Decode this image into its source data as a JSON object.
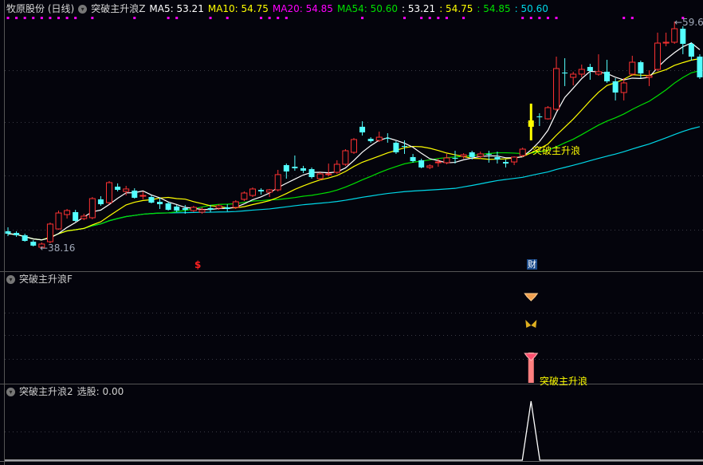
{
  "header": {
    "title": "牧原股份 (日线)",
    "indicator": "突破主升浪Z",
    "ma5_label": "MA5: 53.21",
    "ma10_label": "MA10: 54.75",
    "ma20_label": "MA20: 54.85",
    "ma54_label": "MA54: 50.60",
    "v1": ": 53.21",
    "v2": ": 54.75",
    "v3": ": 54.85",
    "v4": ": 50.60"
  },
  "panel2": {
    "title": "突破主升浪F",
    "signal_label": "突破主升浪"
  },
  "panel3": {
    "title": "突破主升浪2",
    "value_label": "选股: 0.00"
  },
  "markers": {
    "low_label": "←38.16",
    "high_label": "←59.6",
    "signal_label": "突破主升浪",
    "dollar": "$",
    "cai": "财"
  },
  "colors": {
    "up": "#ff3232",
    "down": "#54ffff",
    "signal": "#ffff00",
    "ma5": "#ffffff",
    "ma10": "#ffff00",
    "ma20": "#00e000",
    "ma54": "#00d8e8",
    "dots": "#ff00ff"
  },
  "chart_data": {
    "type": "candlestick",
    "title": "牧原股份 (日线)",
    "price_range": [
      38.16,
      59.6
    ],
    "signal_index": 62,
    "dollar_index": 23,
    "dot_indices": [
      0,
      1,
      2,
      3,
      4,
      5,
      6,
      7,
      8,
      10,
      15,
      19,
      20,
      24,
      26,
      30,
      31,
      32,
      33,
      42,
      47,
      49,
      50,
      51,
      52,
      54,
      61,
      62,
      63,
      64,
      65,
      73,
      74,
      80
    ],
    "ohlc": [
      [
        39.75,
        39.52,
        40.12,
        39.29
      ],
      [
        39.59,
        39.37,
        39.75,
        39.22
      ],
      [
        39.37,
        38.84,
        39.52,
        38.76
      ],
      [
        38.76,
        38.39,
        38.91,
        38.31
      ],
      [
        38.24,
        38.54,
        38.69,
        38.16
      ],
      [
        38.76,
        40.43,
        40.58,
        38.61
      ],
      [
        39.97,
        41.48,
        41.71,
        39.9
      ],
      [
        41.33,
        41.71,
        41.86,
        40.95
      ],
      [
        41.56,
        40.73,
        41.78,
        40.65
      ],
      [
        40.95,
        41.18,
        41.41,
        40.8
      ],
      [
        41.03,
        42.84,
        42.99,
        40.88
      ],
      [
        42.77,
        42.31,
        43.07,
        42.16
      ],
      [
        42.46,
        44.35,
        44.5,
        42.31
      ],
      [
        43.97,
        43.67,
        44.28,
        43.52
      ],
      [
        43.52,
        43.75,
        44.05,
        43.14
      ],
      [
        43.6,
        42.92,
        43.82,
        42.84
      ],
      [
        43.07,
        43.14,
        43.52,
        42.77
      ],
      [
        42.99,
        42.46,
        43.14,
        42.39
      ],
      [
        42.54,
        42.31,
        42.92,
        41.86
      ],
      [
        42.39,
        41.78,
        42.54,
        41.71
      ],
      [
        42.09,
        41.71,
        42.24,
        41.56
      ],
      [
        41.94,
        41.78,
        42.24,
        41.41
      ],
      [
        41.71,
        42.01,
        42.16,
        41.56
      ],
      [
        41.56,
        41.78,
        42.01,
        41.41
      ],
      [
        41.94,
        41.78,
        42.24,
        41.56
      ],
      [
        41.94,
        42.16,
        42.31,
        41.78
      ],
      [
        42.01,
        41.86,
        42.31,
        41.63
      ],
      [
        42.01,
        42.54,
        42.69,
        41.86
      ],
      [
        42.77,
        43.37,
        43.52,
        42.61
      ],
      [
        43.14,
        43.75,
        43.9,
        42.99
      ],
      [
        43.67,
        43.52,
        43.82,
        43.22
      ],
      [
        43.45,
        43.67,
        43.75,
        42.99
      ],
      [
        43.67,
        45.11,
        45.56,
        43.52
      ],
      [
        46.01,
        45.41,
        46.16,
        44.73
      ],
      [
        45.86,
        45.71,
        46.92,
        45.48
      ],
      [
        45.71,
        45.48,
        45.94,
        45.26
      ],
      [
        45.63,
        44.88,
        45.79,
        44.73
      ],
      [
        44.73,
        45.18,
        45.33,
        44.58
      ],
      [
        45.11,
        45.18,
        46.16,
        44.96
      ],
      [
        45.33,
        46.09,
        46.47,
        45.18
      ],
      [
        46.09,
        47.37,
        47.52,
        45.94
      ],
      [
        47.22,
        48.43,
        48.58,
        47.07
      ],
      [
        49.64,
        49.11,
        50.16,
        48.81
      ],
      [
        48.5,
        48.28,
        48.65,
        48.13
      ],
      [
        48.35,
        48.65,
        49.18,
        48.2
      ],
      [
        48.58,
        48.5,
        49.03,
        48.13
      ],
      [
        48.13,
        47.22,
        48.28,
        47.07
      ],
      [
        47.82,
        47.75,
        48.35,
        47.07
      ],
      [
        46.77,
        46.39,
        47.07,
        46.24
      ],
      [
        46.47,
        45.79,
        46.62,
        45.71
      ],
      [
        45.79,
        45.94,
        46.09,
        45.63
      ],
      [
        46.24,
        46.31,
        46.62,
        45.86
      ],
      [
        46.24,
        46.69,
        47.07,
        46.09
      ],
      [
        46.69,
        46.62,
        47.37,
        46.16
      ],
      [
        46.84,
        46.99,
        47.14,
        46.62
      ],
      [
        47.22,
        46.77,
        47.37,
        46.54
      ],
      [
        46.84,
        47.07,
        47.29,
        46.62
      ],
      [
        47.07,
        46.99,
        47.37,
        46.24
      ],
      [
        46.77,
        46.54,
        47.29,
        46.16
      ],
      [
        46.31,
        46.16,
        46.54,
        45.79
      ],
      [
        46.31,
        46.77,
        46.84,
        46.01
      ],
      [
        46.92,
        47.52,
        47.67,
        46.77
      ],
      [
        49.64,
        50.24,
        51.83,
        48.35
      ],
      [
        50.62,
        50.54,
        50.92,
        49.71
      ],
      [
        50.39,
        51.45,
        51.6,
        50.32
      ],
      [
        51.3,
        55.15,
        56.28,
        51.15
      ],
      [
        54.77,
        54.69,
        56.13,
        53.49
      ],
      [
        54.32,
        54.62,
        54.85,
        53.56
      ],
      [
        54.62,
        55.07,
        55.53,
        54.32
      ],
      [
        55.3,
        54.92,
        55.6,
        54.09
      ],
      [
        54.62,
        54.85,
        56.5,
        54.47
      ],
      [
        54.85,
        53.94,
        55.98,
        53.79
      ],
      [
        53.94,
        52.88,
        54.24,
        52.13
      ],
      [
        52.88,
        53.79,
        54.24,
        52.13
      ],
      [
        54.62,
        55.75,
        56.36,
        54.47
      ],
      [
        55.75,
        54.69,
        55.9,
        54.24
      ],
      [
        54.32,
        54.47,
        54.99,
        53.49
      ],
      [
        55.07,
        57.56,
        58.55,
        54.92
      ],
      [
        57.56,
        57.64,
        58.55,
        57.26
      ],
      [
        57.64,
        58.92,
        59.6,
        57.49
      ],
      [
        58.92,
        57.49,
        59.15,
        56.51
      ],
      [
        57.49,
        56.28,
        57.64,
        55.9
      ],
      [
        56.28,
        54.32,
        56.5,
        54.17
      ]
    ],
    "ma_periods": [
      5,
      10,
      20,
      54
    ],
    "panel3_signal": [
      0,
      1
    ]
  }
}
